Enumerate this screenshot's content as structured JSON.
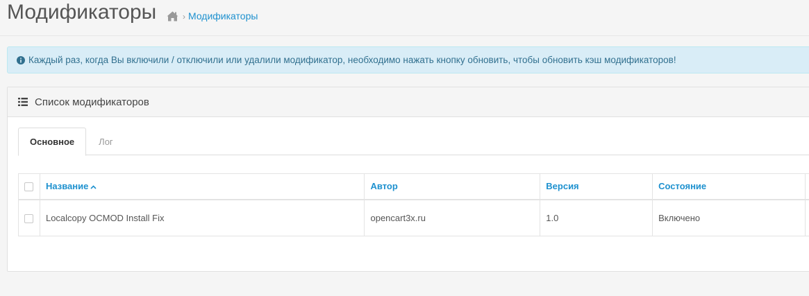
{
  "header": {
    "title": "Модификаторы",
    "breadcrumb": [
      "home-icon",
      "Модификаторы"
    ]
  },
  "alert": {
    "icon": "info-circle-icon",
    "text": "Каждый раз, когда Вы включили / отключили или удалили модификатор, необходимо нажать кнопку обновить, чтобы обновить кэш модификаторов!"
  },
  "panel": {
    "icon": "list-icon",
    "title": "Список модификаторов",
    "tabs": [
      {
        "label": "Основное",
        "active": true
      },
      {
        "label": "Лог",
        "active": false
      }
    ],
    "table": {
      "columns": [
        "Название",
        "Автор",
        "Версия",
        "Состояние"
      ],
      "sort_column": "Название",
      "sort_direction": "asc",
      "rows": [
        {
          "name": "Localcopy OCMOD Install Fix",
          "author": "opencart3x.ru",
          "version": "1.0",
          "status": "Включено"
        }
      ]
    }
  },
  "colors": {
    "link": "#1e91cf",
    "alert_bg": "#d9edf7",
    "alert_text": "#31708f"
  }
}
